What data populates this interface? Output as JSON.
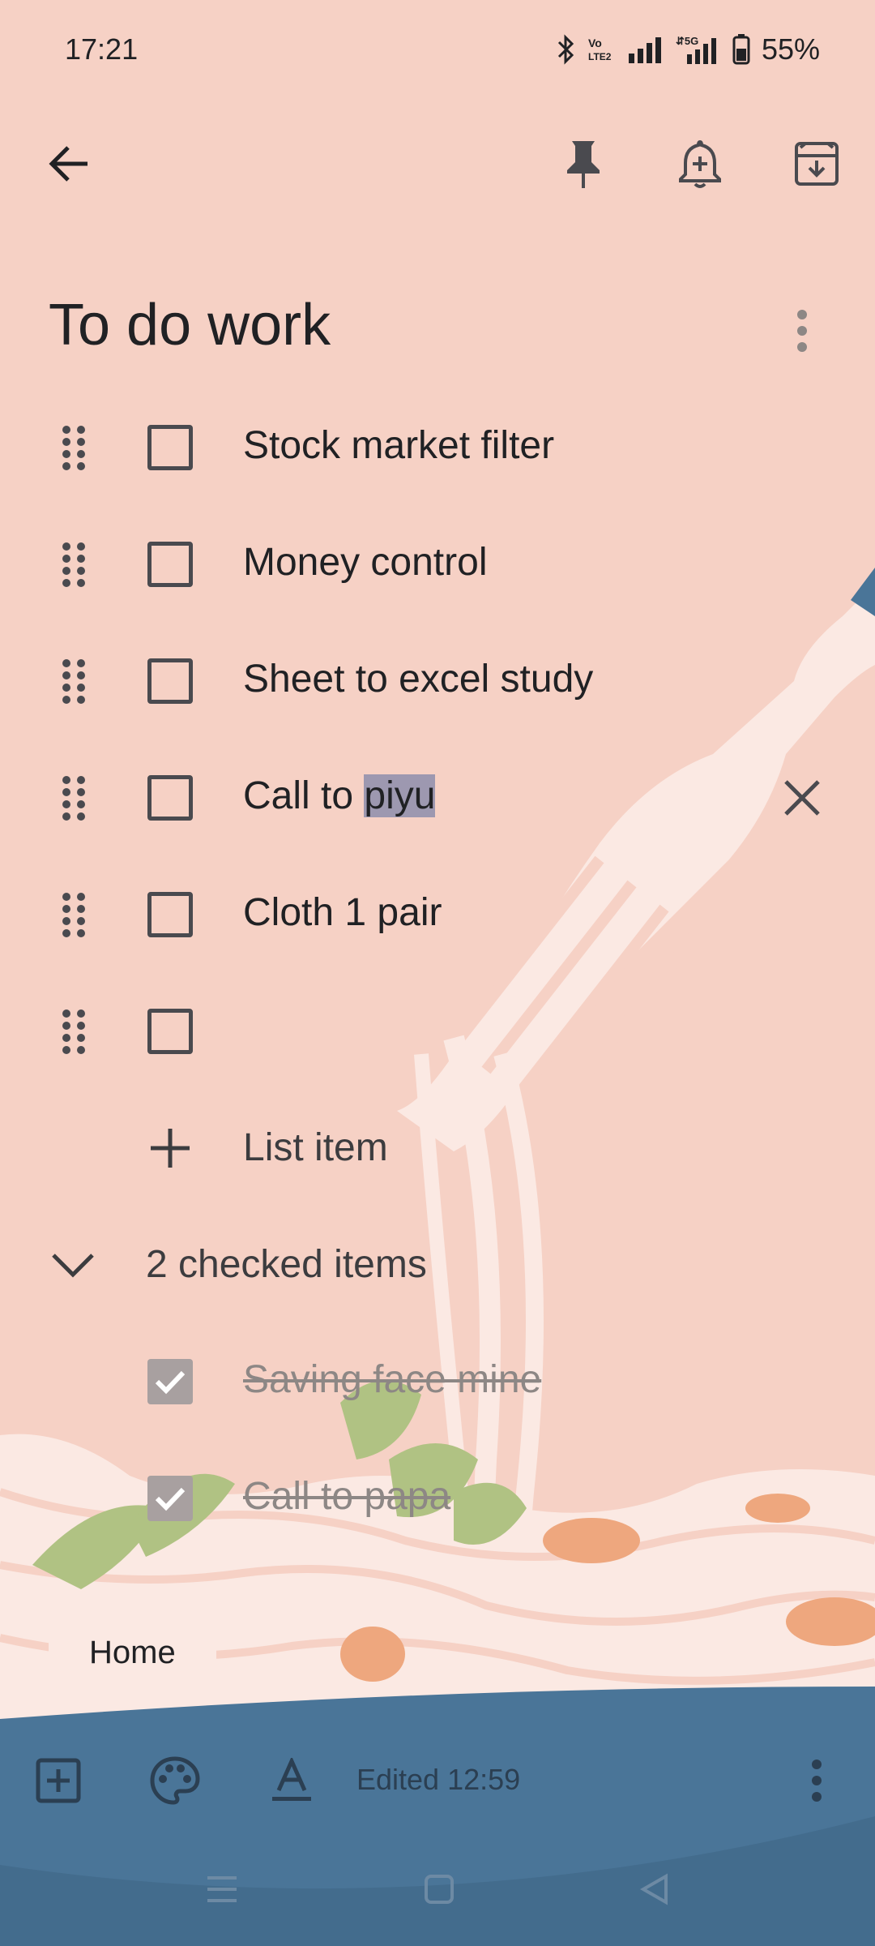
{
  "status_bar": {
    "time": "17:21",
    "battery": "55%",
    "icons": [
      "bluetooth-icon",
      "volte-icon",
      "signal-icon",
      "5g-signal-icon",
      "battery-icon"
    ]
  },
  "toolbar": {
    "back_icon": "arrow-back-icon",
    "pin_icon": "pin-icon",
    "reminder_icon": "add-alert-icon",
    "archive_icon": "archive-icon"
  },
  "note": {
    "title": "To do work",
    "items": [
      {
        "text": "Stock market filter",
        "checked": false
      },
      {
        "text": "Money control",
        "checked": false
      },
      {
        "text": "Sheet to excel study",
        "checked": false
      },
      {
        "text_before": "Call to ",
        "text_selected": "piyu",
        "checked": false,
        "focused": true
      },
      {
        "text": "Cloth 1 pair",
        "checked": false
      },
      {
        "text": "",
        "checked": false
      }
    ],
    "add_item_label": "List item",
    "checked_header": "2 checked items",
    "checked_items": [
      {
        "text": "Saving face mine",
        "checked": true
      },
      {
        "text": "Call to papa",
        "checked": true
      }
    ],
    "label_chip": "Home"
  },
  "bottom_bar": {
    "edited": "Edited 12:59"
  },
  "colors": {
    "background": "#f6d1c5",
    "bottom_bar": "#4a7598",
    "selection": "#9d98b0"
  }
}
